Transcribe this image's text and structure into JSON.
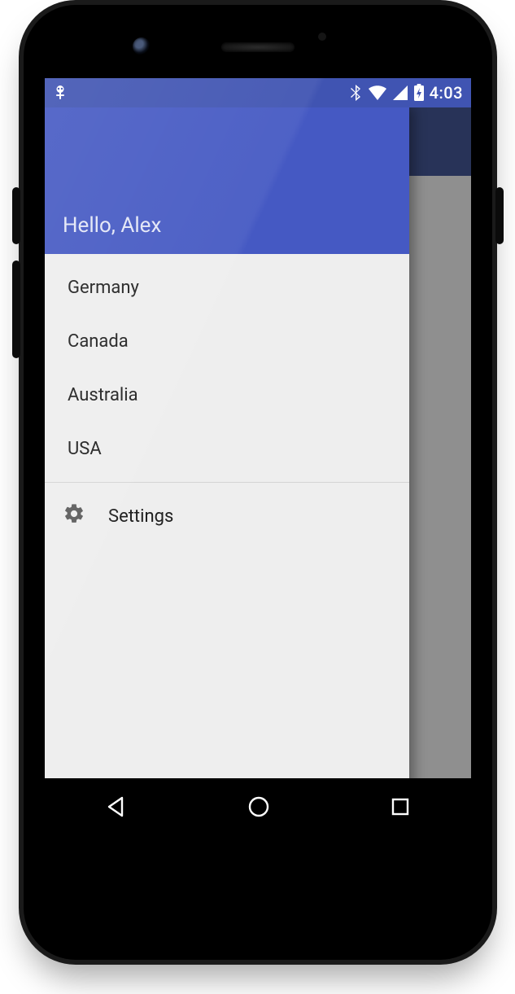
{
  "statusbar": {
    "time": "4:03"
  },
  "drawer": {
    "greeting": "Hello, Alex",
    "nav_items": [
      {
        "label": "Germany"
      },
      {
        "label": "Canada"
      },
      {
        "label": "Australia"
      },
      {
        "label": "USA"
      }
    ],
    "settings_label": "Settings"
  },
  "colors": {
    "primary": "#4559c3",
    "primaryDark": "#4054b2",
    "appbarBehind": "#283358",
    "drawerBg": "#eeeeee",
    "scrim": "#8f8f8f"
  }
}
